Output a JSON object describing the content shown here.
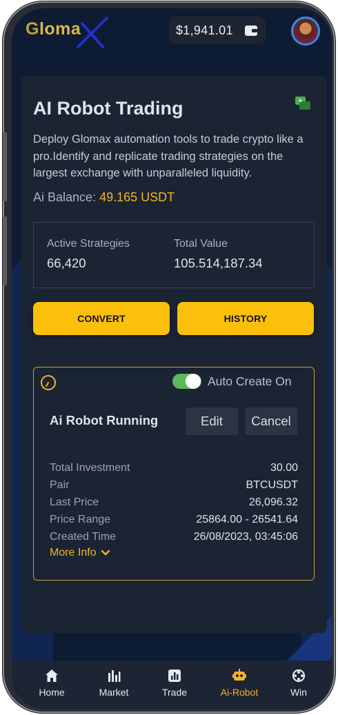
{
  "header": {
    "logo_text_g": "G",
    "logo_text_rest": "loma",
    "balance": "$1,941.01"
  },
  "card": {
    "title": "AI Robot Trading",
    "description": "Deploy Glomax automation tools to trade crypto like a pro.Identify and replicate trading strategies on the largest exchange with unparalleled liquidity.",
    "ai_balance_label": "Ai Balance:",
    "ai_balance_value": "49.165 USDT",
    "stats": {
      "active_label": "Active Strategies",
      "active_value": "66,420",
      "total_label": "Total Value",
      "total_value": "105.514,187.34"
    },
    "convert_label": "CONVERT",
    "history_label": "HISTORY"
  },
  "robot": {
    "auto_create_label": "Auto Create On",
    "auto_create_on": true,
    "title": "Ai Robot Running",
    "edit_label": "Edit",
    "cancel_label": "Cancel",
    "details": [
      {
        "label": "Total Investment",
        "value": "30.00"
      },
      {
        "label": "Pair",
        "value": "BTCUSDT"
      },
      {
        "label": "Last Price",
        "value": "26,096.32"
      },
      {
        "label": "Price Range",
        "value": "25864.00 - 26541.64"
      },
      {
        "label": "Created Time",
        "value": "26/08/2023, 03:45:06"
      }
    ],
    "more_info_label": "More Info"
  },
  "nav": {
    "items": [
      {
        "label": "Home",
        "icon": "home-icon"
      },
      {
        "label": "Market",
        "icon": "market-icon"
      },
      {
        "label": "Trade",
        "icon": "trade-icon"
      },
      {
        "label": "Ai-Robot",
        "icon": "robot-icon",
        "active": true
      },
      {
        "label": "Win",
        "icon": "win-icon"
      }
    ]
  },
  "colors": {
    "accent": "#fcbf0c",
    "background": "#0d1b33",
    "card": "#1b2433",
    "toggle_on": "#5cb85c"
  }
}
